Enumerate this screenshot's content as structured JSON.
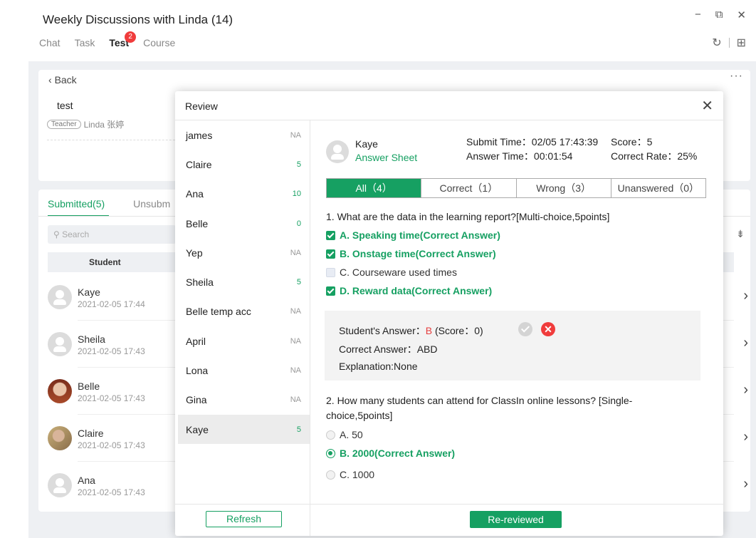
{
  "window": {
    "title": "Weekly Discussions with Linda (14)",
    "tabs": [
      {
        "label": "Chat"
      },
      {
        "label": "Task"
      },
      {
        "label": "Test",
        "badge": "2"
      },
      {
        "label": "Course"
      }
    ]
  },
  "background": {
    "back_label": "Back",
    "test_name": "test",
    "teacher_tag": "Teacher",
    "teacher_name": "Linda 张婷",
    "submitted_tab": "Submitted(5)",
    "unsubmitted_tab": "Unsubm",
    "search_placeholder": "Search",
    "student_header": "Student",
    "students": [
      {
        "name": "Kaye",
        "time": "2021-02-05 17:44"
      },
      {
        "name": "Sheila",
        "time": "2021-02-05 17:43"
      },
      {
        "name": "Belle",
        "time": "2021-02-05 17:43"
      },
      {
        "name": "Claire",
        "time": "2021-02-05 17:43"
      },
      {
        "name": "Ana",
        "time": "2021-02-05 17:43"
      }
    ]
  },
  "review": {
    "title": "Review",
    "list": [
      {
        "name": "james",
        "score": "NA"
      },
      {
        "name": "Claire",
        "score": "5"
      },
      {
        "name": "Ana",
        "score": "10"
      },
      {
        "name": "Belle",
        "score": "0"
      },
      {
        "name": "Yep",
        "score": "NA"
      },
      {
        "name": "Sheila",
        "score": "5"
      },
      {
        "name": "Belle temp acc",
        "score": "NA"
      },
      {
        "name": "April",
        "score": "NA"
      },
      {
        "name": "Lona",
        "score": "NA"
      },
      {
        "name": "Gina",
        "score": "NA"
      },
      {
        "name": "Kaye",
        "score": "5"
      }
    ],
    "refresh_label": "Refresh",
    "rereviewed_label": "Re-reviewed",
    "detail": {
      "student_name": "Kaye",
      "answer_sheet": "Answer Sheet",
      "submit_time": "Submit Time：02/05 17:43:39",
      "answer_time": "Answer Time：00:01:54",
      "score": "Score：5",
      "correct_rate": "Correct Rate：25%",
      "filters": [
        "All（4）",
        "Correct（1）",
        "Wrong（3）",
        "Unanswered（0）"
      ],
      "q1": {
        "text": "1. What are the data in the learning report?[Multi-choice,5points]",
        "options": [
          "A. Speaking time(Correct Answer)",
          "B. Onstage time(Correct Answer)",
          "C. Courseware used times",
          "D. Reward data(Correct Answer)"
        ],
        "student_answer_label": "Student's Answer：",
        "student_answer_value": "B",
        "student_answer_score": "(Score：0)",
        "correct_answer": "Correct Answer：ABD",
        "explanation": "Explanation:None"
      },
      "q2": {
        "text": "2. How many students can attend for ClassIn online lessons? [Single-choice,5points]",
        "options": [
          "A. 50",
          "B. 2000(Correct Answer)",
          "C. 1000"
        ]
      }
    }
  },
  "colors": {
    "accent": "#16a062",
    "badge": "#f03c3c"
  }
}
